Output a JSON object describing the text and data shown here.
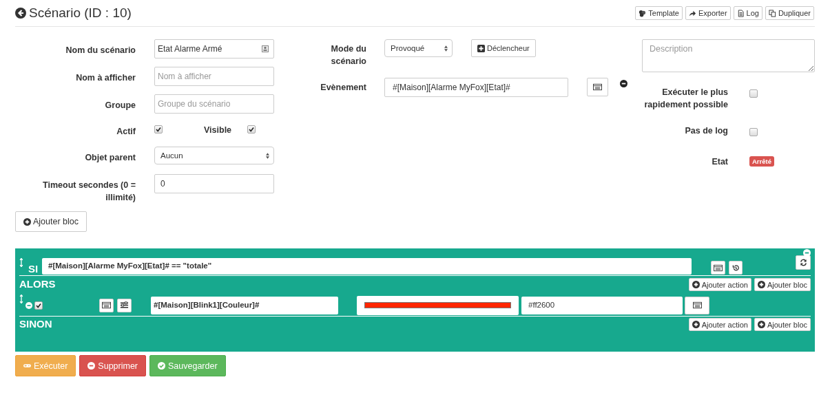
{
  "header": {
    "title": "Scénario (ID : 10)",
    "actions": [
      {
        "label": "Template",
        "kind": "template"
      },
      {
        "label": "Exporter",
        "kind": "export"
      },
      {
        "label": "Log",
        "kind": "log"
      },
      {
        "label": "Dupliquer",
        "kind": "copy"
      }
    ]
  },
  "general": {
    "name": {
      "label": "Nom du scénario",
      "value": "Etat Alarme Armé"
    },
    "display_name": {
      "label": "Nom à afficher",
      "placeholder": "Nom à afficher"
    },
    "group": {
      "label": "Groupe",
      "placeholder": "Groupe du scénario"
    },
    "active": {
      "label": "Actif",
      "checked": true
    },
    "visible": {
      "label": "Visible",
      "checked": true
    },
    "parent": {
      "label": "Objet parent",
      "value": "Aucun"
    },
    "timeout": {
      "label": "Timeout secondes (0 = illimité)",
      "value": "0"
    }
  },
  "add_block_button": "Ajouter bloc",
  "trigger": {
    "mode": {
      "label": "Mode du scénario",
      "value": "Provoqué"
    },
    "trigger_button": "Déclencheur",
    "event": {
      "label": "Evènement",
      "value": "#[Maison][Alarme MyFox][Etat]#"
    }
  },
  "options": {
    "description": {
      "placeholder": "Description"
    },
    "fast_exec": {
      "label": "Exécuter le plus rapidement possible",
      "checked": false
    },
    "no_log": {
      "label": "Pas de log",
      "checked": false
    },
    "state": {
      "label": "Etat",
      "value": "Arrêté"
    }
  },
  "block": {
    "if_label": "SI",
    "condition": "#[Maison][Alarme MyFox][Etat]# == \"totale\"",
    "then_label": "ALORS",
    "then_buttons": [
      "Ajouter action",
      "Ajouter bloc"
    ],
    "actions": [
      {
        "enabled": true,
        "command": "#[Maison][Blink1][Couleur]#",
        "color": "#ff2600",
        "value": "#ff2600"
      }
    ],
    "else_label": "SINON",
    "else_buttons": [
      "Ajouter action",
      "Ajouter bloc"
    ]
  },
  "footer_buttons": [
    {
      "label": "Exécuter",
      "kind": "run"
    },
    {
      "label": "Supprimer",
      "kind": "delete"
    },
    {
      "label": "Sauvegarder",
      "kind": "save"
    }
  ]
}
